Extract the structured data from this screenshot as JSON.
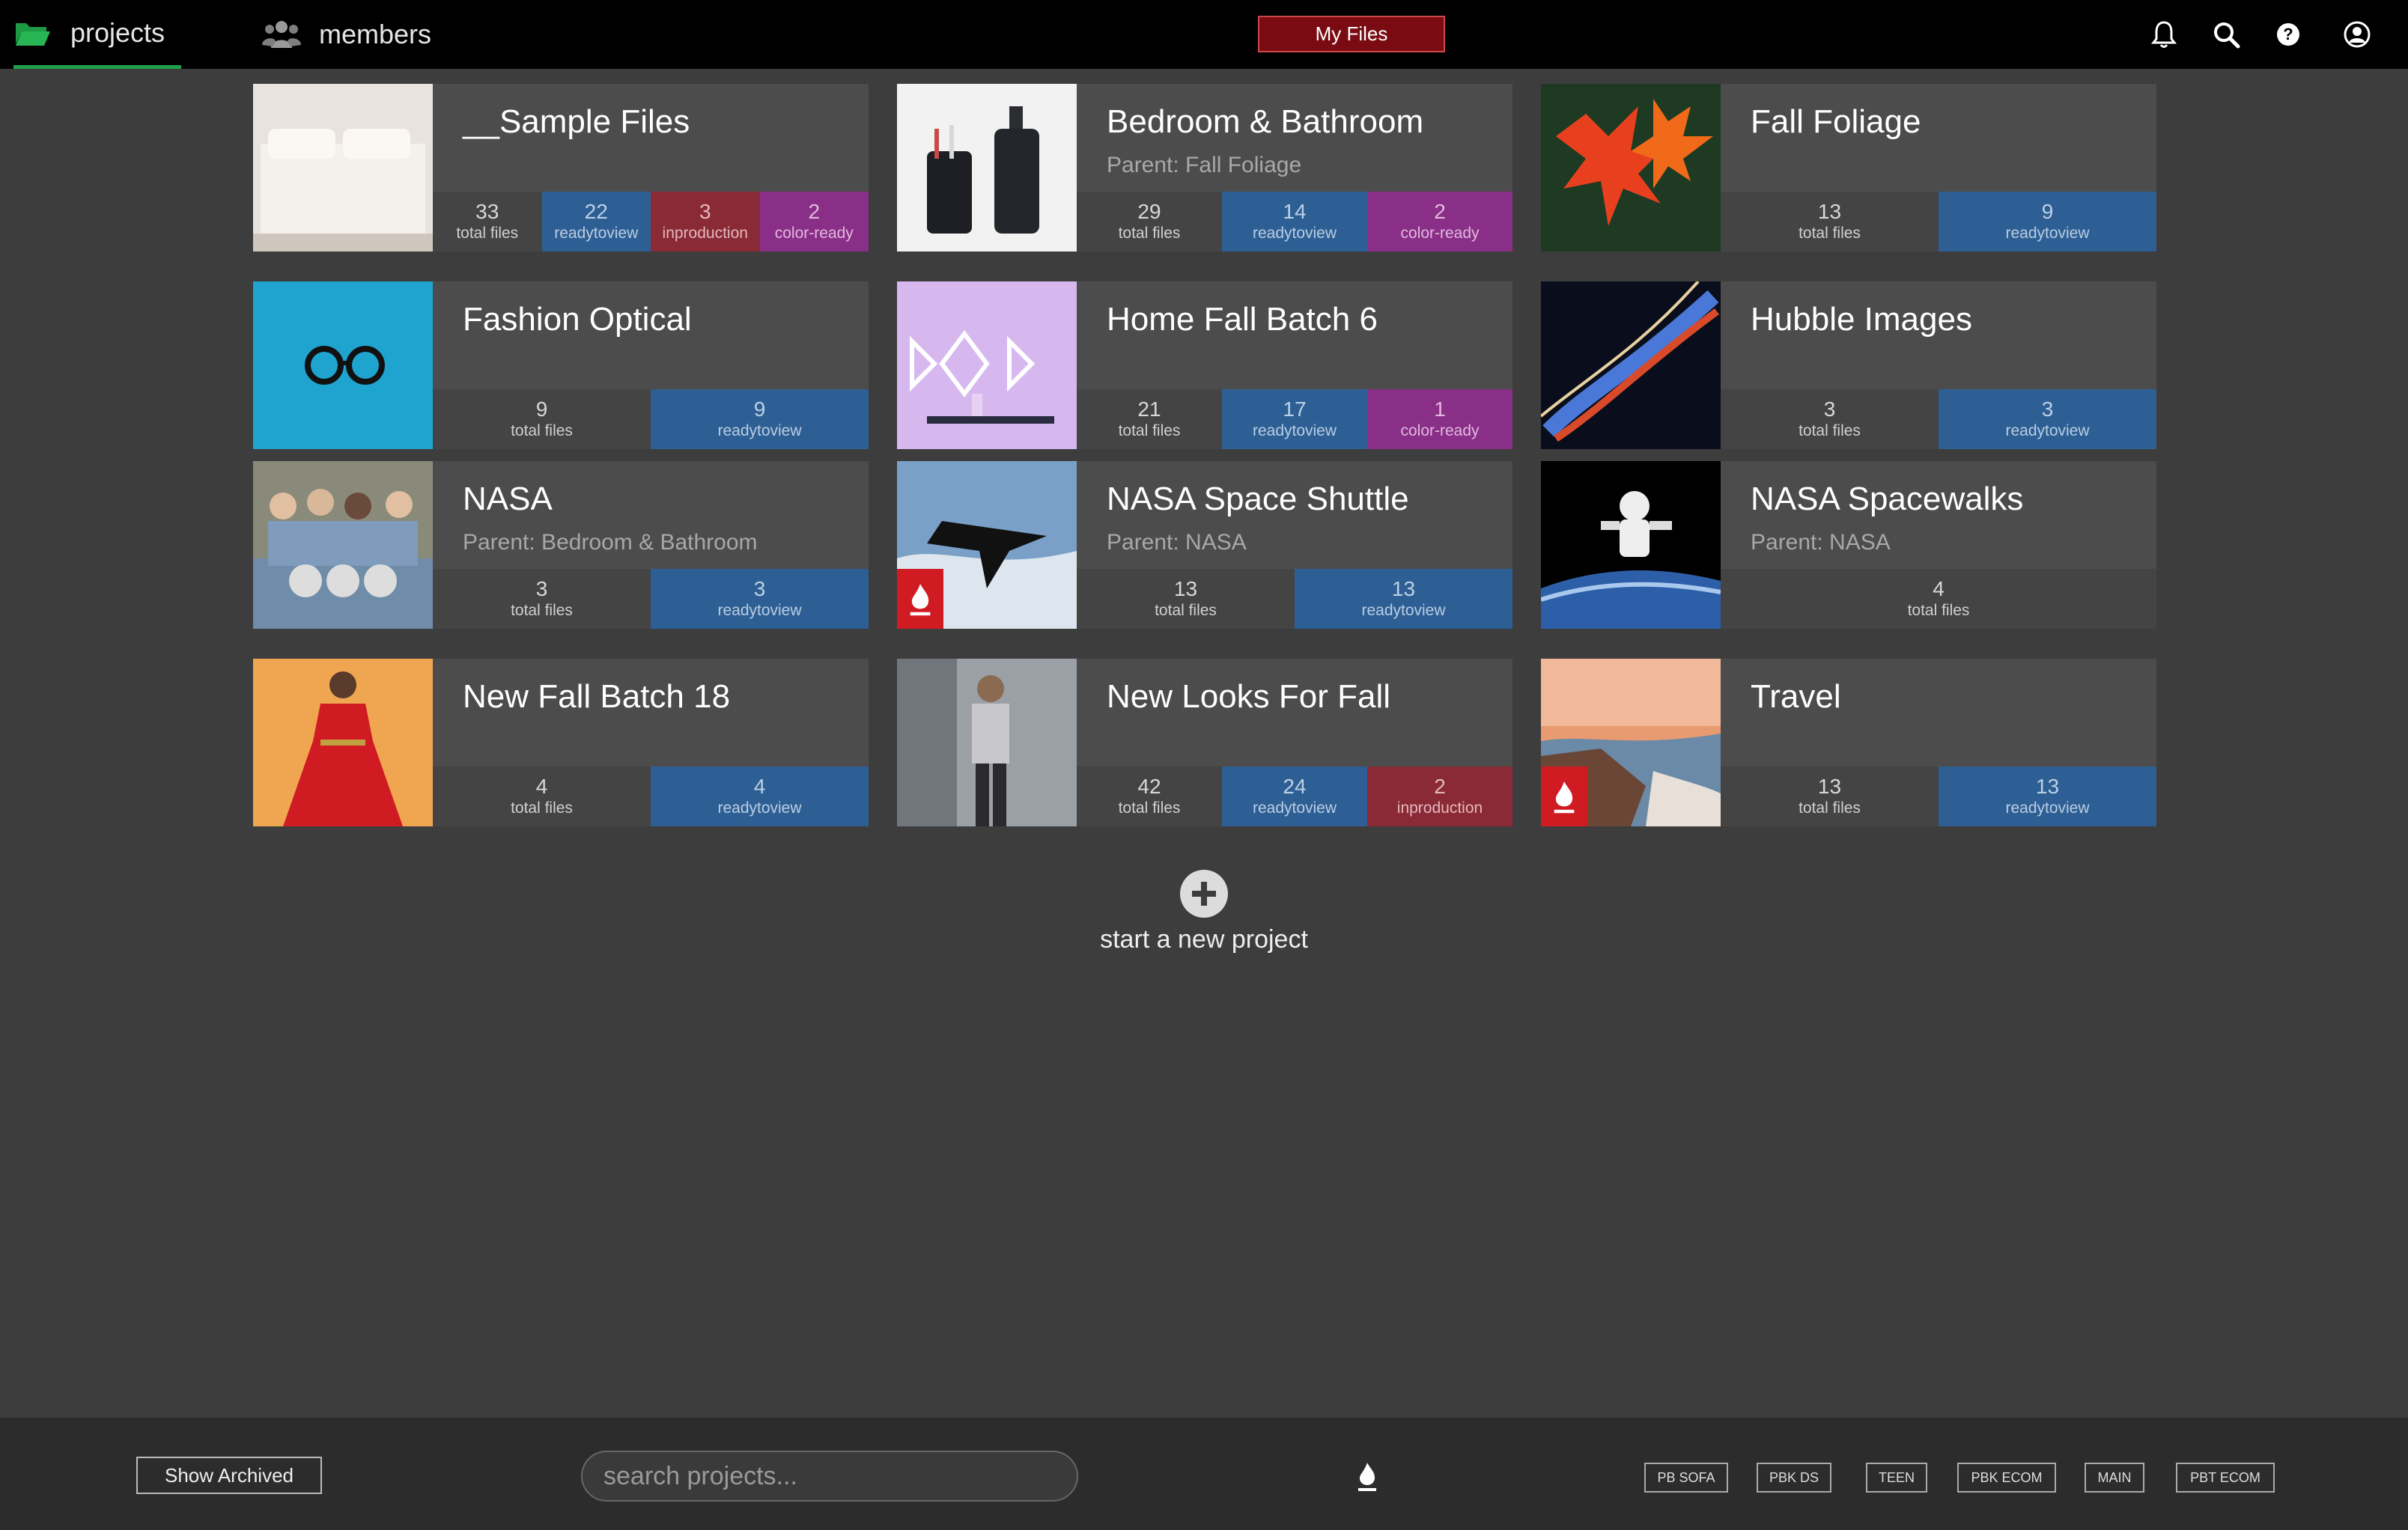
{
  "nav": {
    "projects_label": "projects",
    "members_label": "members",
    "myfiles_label": "My Files",
    "icons": [
      "bell-icon",
      "search-icon",
      "help-icon",
      "user-icon"
    ]
  },
  "projects": [
    {
      "title": "__Sample Files",
      "parent": "",
      "stats": [
        {
          "num": "33",
          "label": "total files",
          "kind": "gray"
        },
        {
          "num": "22",
          "label": "readytoview",
          "kind": "blue"
        },
        {
          "num": "3",
          "label": "inproduction",
          "kind": "red"
        },
        {
          "num": "2",
          "label": "color-ready",
          "kind": "purple"
        }
      ]
    },
    {
      "title": "Bedroom & Bathroom",
      "parent": "Parent: Fall Foliage",
      "stats": [
        {
          "num": "29",
          "label": "total files",
          "kind": "gray"
        },
        {
          "num": "14",
          "label": "readytoview",
          "kind": "blue"
        },
        {
          "num": "2",
          "label": "color-ready",
          "kind": "purple"
        }
      ]
    },
    {
      "title": "Fall Foliage",
      "parent": "",
      "stats": [
        {
          "num": "13",
          "label": "total files",
          "kind": "gray"
        },
        {
          "num": "9",
          "label": "readytoview",
          "kind": "blue"
        }
      ]
    },
    {
      "title": "Fashion Optical",
      "parent": "",
      "stats": [
        {
          "num": "9",
          "label": "total files",
          "kind": "gray"
        },
        {
          "num": "9",
          "label": "readytoview",
          "kind": "blue"
        }
      ]
    },
    {
      "title": "Home Fall Batch 6",
      "parent": "",
      "stats": [
        {
          "num": "21",
          "label": "total files",
          "kind": "gray"
        },
        {
          "num": "17",
          "label": "readytoview",
          "kind": "blue"
        },
        {
          "num": "1",
          "label": "color-ready",
          "kind": "purple"
        }
      ]
    },
    {
      "title": "Hubble Images",
      "parent": "",
      "stats": [
        {
          "num": "3",
          "label": "total files",
          "kind": "gray"
        },
        {
          "num": "3",
          "label": "readytoview",
          "kind": "blue"
        }
      ]
    },
    {
      "title": "NASA",
      "parent": "Parent: Bedroom & Bathroom",
      "stats": [
        {
          "num": "3",
          "label": "total files",
          "kind": "gray"
        },
        {
          "num": "3",
          "label": "readytoview",
          "kind": "blue"
        }
      ]
    },
    {
      "title": "NASA Space Shuttle",
      "parent": "Parent: NASA",
      "badge": true,
      "stats": [
        {
          "num": "13",
          "label": "total files",
          "kind": "gray"
        },
        {
          "num": "13",
          "label": "readytoview",
          "kind": "blue"
        }
      ]
    },
    {
      "title": "NASA Spacewalks",
      "parent": "Parent: NASA",
      "stats": [
        {
          "num": "4",
          "label": "total files",
          "kind": "gray"
        }
      ]
    },
    {
      "title": "New Fall Batch 18",
      "parent": "",
      "stats": [
        {
          "num": "4",
          "label": "total files",
          "kind": "gray"
        },
        {
          "num": "4",
          "label": "readytoview",
          "kind": "blue"
        }
      ]
    },
    {
      "title": "New Looks For Fall",
      "parent": "",
      "stats": [
        {
          "num": "42",
          "label": "total files",
          "kind": "gray"
        },
        {
          "num": "24",
          "label": "readytoview",
          "kind": "blue"
        },
        {
          "num": "2",
          "label": "inproduction",
          "kind": "red"
        }
      ]
    },
    {
      "title": "Travel",
      "parent": "",
      "badge": true,
      "stats": [
        {
          "num": "13",
          "label": "total files",
          "kind": "gray"
        },
        {
          "num": "13",
          "label": "readytoview",
          "kind": "blue"
        }
      ]
    }
  ],
  "new_project_label": "start a new project",
  "footer": {
    "show_archived_label": "Show Archived",
    "search_placeholder": "search projects...",
    "tags": [
      "PB SOFA",
      "PBK DS",
      "TEEN",
      "PBK ECOM",
      "MAIN",
      "PBT ECOM"
    ]
  },
  "colors": {
    "blue": "#2e5f94",
    "red": "#8a2a36",
    "purple": "#8a2f88",
    "accent": "#21a04a",
    "myfiles": "#7a0b12"
  }
}
